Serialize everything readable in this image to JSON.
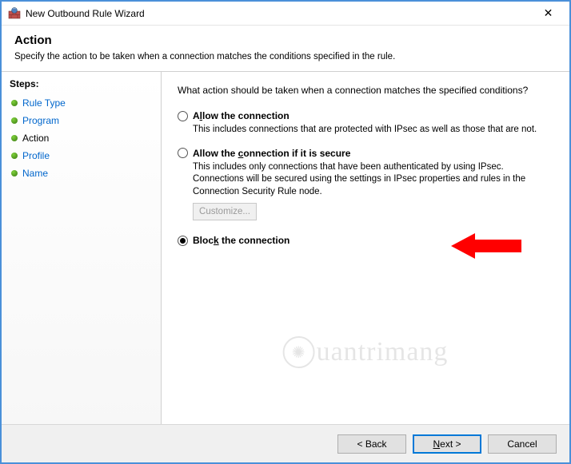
{
  "window": {
    "title": "New Outbound Rule Wizard",
    "close_label": "✕"
  },
  "header": {
    "heading": "Action",
    "subtitle": "Specify the action to be taken when a connection matches the conditions specified in the rule."
  },
  "steps": {
    "title": "Steps:",
    "items": [
      {
        "label": "Rule Type",
        "current": false
      },
      {
        "label": "Program",
        "current": false
      },
      {
        "label": "Action",
        "current": true
      },
      {
        "label": "Profile",
        "current": false
      },
      {
        "label": "Name",
        "current": false
      }
    ]
  },
  "content": {
    "question": "What action should be taken when a connection matches the specified conditions?",
    "options": {
      "allow": {
        "label_pre": "A",
        "label_u": "l",
        "label_post": "low the connection",
        "desc": "This includes connections that are protected with IPsec as well as those that are not.",
        "checked": false
      },
      "allow_secure": {
        "label_pre": "Allow the ",
        "label_u": "c",
        "label_post": "onnection if it is secure",
        "desc": "This includes only connections that have been authenticated by using IPsec. Connections will be secured using the settings in IPsec properties and rules in the Connection Security Rule node.",
        "checked": false,
        "customize_label": "Customize...",
        "customize_enabled": false
      },
      "block": {
        "label_pre": "Bloc",
        "label_u": "k",
        "label_post": " the connection",
        "checked": true
      }
    }
  },
  "footer": {
    "back": "< Back",
    "next_pre": "",
    "next_u": "N",
    "next_post": "ext >",
    "cancel": "Cancel"
  },
  "watermark": "uantrimang"
}
